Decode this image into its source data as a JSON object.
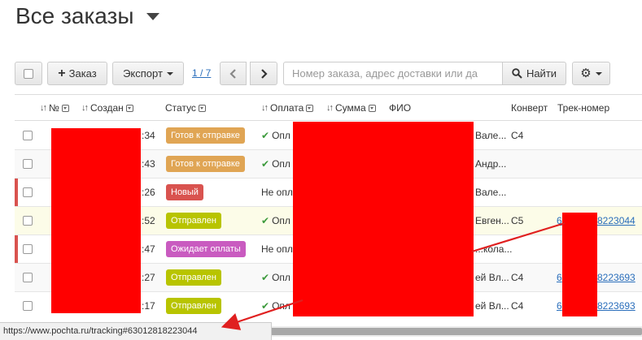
{
  "page": {
    "title": "Все заказы"
  },
  "toolbar": {
    "add_order_label": "Заказ",
    "export_label": "Экспорт",
    "pagination": "1 / 7",
    "search_placeholder": "Номер заказа, адрес доставки или да",
    "find_label": "Найти"
  },
  "table": {
    "headers": {
      "number": "№",
      "created": "Создан",
      "status": "Статус",
      "payment": "Оплата",
      "amount": "Сумма",
      "fio": "ФИО",
      "envelope": "Конверт",
      "tracking": "Трек-номер"
    },
    "rows": [
      {
        "created": ":34",
        "status": "Готов к отправке",
        "status_color": "#e0a554",
        "payment": "Опл",
        "paid": true,
        "fio": "Вале...",
        "envelope": "C4",
        "tracking": "",
        "marked": false
      },
      {
        "created": ":43",
        "status": "Готов к отправке",
        "status_color": "#e0a554",
        "payment": "Опл",
        "paid": true,
        "fio": "Андр...",
        "envelope": "",
        "tracking": "",
        "marked": false
      },
      {
        "created": ":26",
        "status": "Новый",
        "status_color": "#d9534f",
        "payment": "Не опл",
        "paid": false,
        "fio": "Вале...",
        "envelope": "",
        "tracking": "",
        "marked": true
      },
      {
        "created": ":52",
        "status": "Отправлен",
        "status_color": "#b8c400",
        "payment": "Опл",
        "paid": true,
        "fio": "Евген...",
        "envelope": "C5",
        "tracking_pre": "6",
        "tracking": "8223044",
        "marked": false
      },
      {
        "created": ":47",
        "status": "Ожидает оплаты",
        "status_color": "#c95bc0",
        "payment": "Не опл",
        "paid": false,
        "fio": "...кола...",
        "envelope": "",
        "tracking": "",
        "marked": true
      },
      {
        "created": ":27",
        "status": "Отправлен",
        "status_color": "#b8c400",
        "payment": "Опл",
        "paid": true,
        "fio": "ей Вл...",
        "envelope": "C4",
        "tracking_pre": "6",
        "tracking": "8223693",
        "marked": false
      },
      {
        "created": ":17",
        "status": "Отправлен",
        "status_color": "#b8c400",
        "payment": "Опл",
        "paid": true,
        "fio": "ей Вл...",
        "envelope": "C4",
        "tracking_pre": "6",
        "tracking": "8223693",
        "marked": false
      }
    ]
  },
  "statusbar": {
    "url": "https://www.pochta.ru/tracking#63012818223044"
  },
  "colors": {
    "link": "#2a6ebb",
    "redaction": "#ff0000",
    "annotation_arrow": "#e02020"
  }
}
